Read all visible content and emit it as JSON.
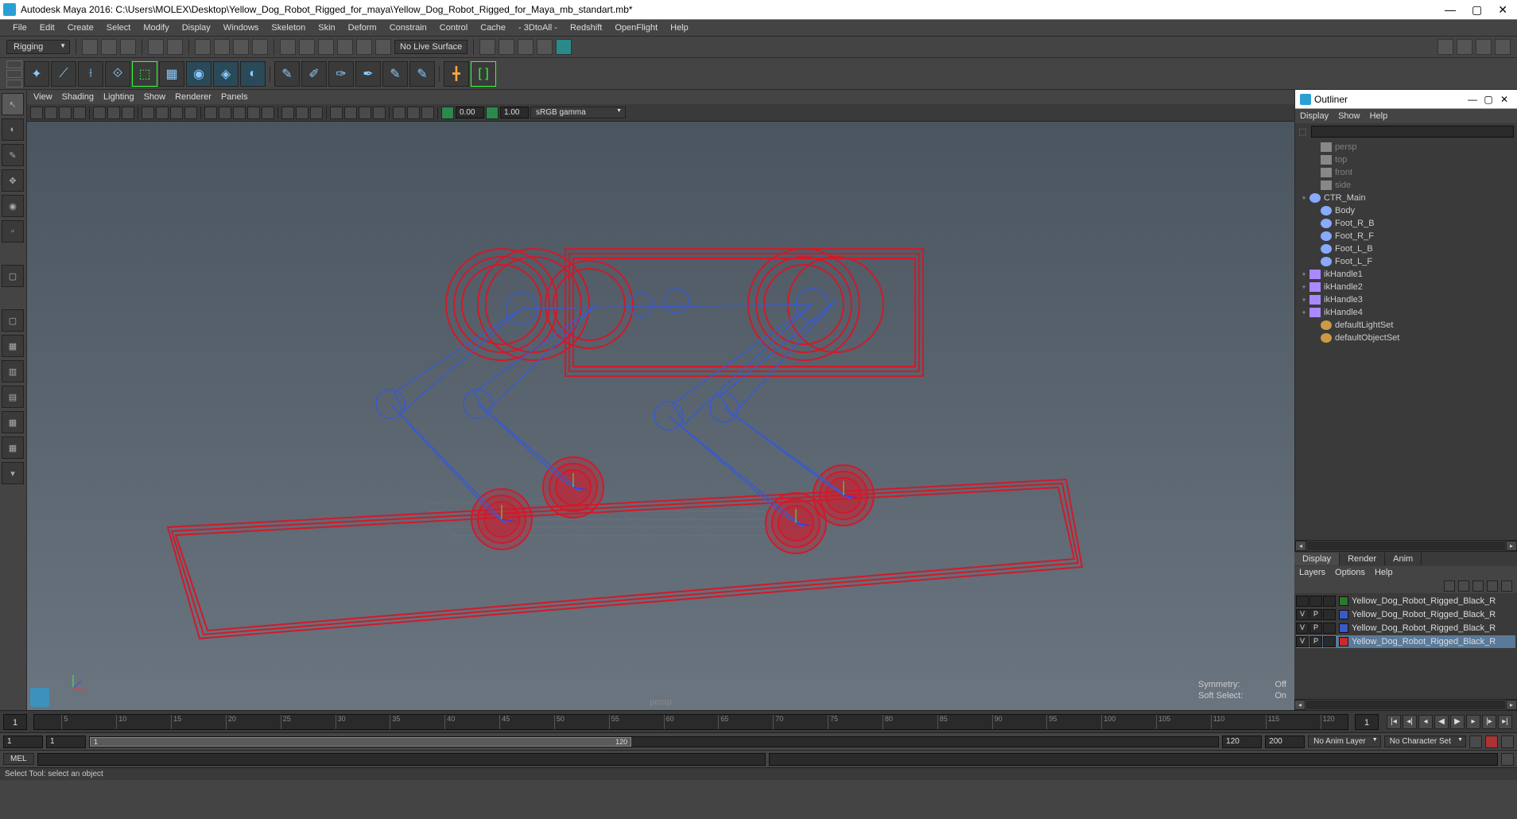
{
  "titlebar": {
    "text": "Autodesk Maya 2016: C:\\Users\\MOLEX\\Desktop\\Yellow_Dog_Robot_Rigged_for_maya\\Yellow_Dog_Robot_Rigged_for_Maya_mb_standart.mb*"
  },
  "menubar": {
    "items": [
      "File",
      "Edit",
      "Create",
      "Select",
      "Modify",
      "Display",
      "Windows",
      "Skeleton",
      "Skin",
      "Deform",
      "Constrain",
      "Control",
      "Cache",
      "- 3DtoAll -",
      "Redshift",
      "OpenFlight",
      "Help"
    ]
  },
  "workspace": {
    "selected": "Rigging"
  },
  "toolbar1": {
    "no_live_surface": "No Live Surface"
  },
  "panel_menu": {
    "items": [
      "View",
      "Shading",
      "Lighting",
      "Show",
      "Renderer",
      "Panels"
    ]
  },
  "panel_toolbar": {
    "val1": "0.00",
    "val2": "1.00",
    "color_mgmt": "sRGB gamma"
  },
  "viewport": {
    "camera": "persp",
    "symmetry_label": "Symmetry:",
    "symmetry_value": "Off",
    "soft_label": "Soft Select:",
    "soft_value": "On"
  },
  "outliner": {
    "title": "Outliner",
    "menu": [
      "Display",
      "Show",
      "Help"
    ],
    "items": [
      {
        "name": "persp",
        "type": "cam",
        "dimmed": true,
        "expand": "",
        "indent": 1
      },
      {
        "name": "top",
        "type": "cam",
        "dimmed": true,
        "expand": "",
        "indent": 1
      },
      {
        "name": "front",
        "type": "cam",
        "dimmed": true,
        "expand": "",
        "indent": 1
      },
      {
        "name": "side",
        "type": "cam",
        "dimmed": true,
        "expand": "",
        "indent": 1
      },
      {
        "name": "CTR_Main",
        "type": "nurbs",
        "dimmed": false,
        "expand": "+",
        "indent": 0
      },
      {
        "name": "Body",
        "type": "nurbs",
        "dimmed": false,
        "expand": "",
        "indent": 1
      },
      {
        "name": "Foot_R_B",
        "type": "nurbs",
        "dimmed": false,
        "expand": "",
        "indent": 1
      },
      {
        "name": "Foot_R_F",
        "type": "nurbs",
        "dimmed": false,
        "expand": "",
        "indent": 1
      },
      {
        "name": "Foot_L_B",
        "type": "nurbs",
        "dimmed": false,
        "expand": "",
        "indent": 1
      },
      {
        "name": "Foot_L_F",
        "type": "nurbs",
        "dimmed": false,
        "expand": "",
        "indent": 1
      },
      {
        "name": "ikHandle1",
        "type": "ik",
        "dimmed": false,
        "expand": "+",
        "indent": 0
      },
      {
        "name": "ikHandle2",
        "type": "ik",
        "dimmed": false,
        "expand": "+",
        "indent": 0
      },
      {
        "name": "ikHandle3",
        "type": "ik",
        "dimmed": false,
        "expand": "+",
        "indent": 0
      },
      {
        "name": "ikHandle4",
        "type": "ik",
        "dimmed": false,
        "expand": "+",
        "indent": 0
      },
      {
        "name": "defaultLightSet",
        "type": "set",
        "dimmed": false,
        "expand": "",
        "indent": 1
      },
      {
        "name": "defaultObjectSet",
        "type": "set",
        "dimmed": false,
        "expand": "",
        "indent": 1
      }
    ]
  },
  "chbox": {
    "tabs": [
      "Display",
      "Render",
      "Anim"
    ],
    "active_tab": "Display",
    "menu": [
      "Layers",
      "Options",
      "Help"
    ],
    "layers": [
      {
        "v": "",
        "p": "",
        "color": "#2a7a2a",
        "name": "Yellow_Dog_Robot_Rigged_Black_R",
        "selected": false
      },
      {
        "v": "V",
        "p": "P",
        "color": "#3a5acc",
        "name": "Yellow_Dog_Robot_Rigged_Black_R",
        "selected": false
      },
      {
        "v": "V",
        "p": "P",
        "color": "#3a5acc",
        "name": "Yellow_Dog_Robot_Rigged_Black_R",
        "selected": false
      },
      {
        "v": "V",
        "p": "P",
        "color": "#cc2a2a",
        "name": "Yellow_Dog_Robot_Rigged_Black_R",
        "selected": true
      }
    ]
  },
  "timeline": {
    "current": "1",
    "end": "1",
    "ticks": [
      "5",
      "10",
      "15",
      "20",
      "25",
      "30",
      "35",
      "40",
      "45",
      "50",
      "55",
      "60",
      "65",
      "70",
      "75",
      "80",
      "85",
      "90",
      "95",
      "100",
      "105",
      "110",
      "115",
      "120"
    ]
  },
  "range": {
    "start": "1",
    "ps": "1",
    "handle": "1",
    "pe_val": "120",
    "pe": "120",
    "end": "200",
    "anim_layer": "No Anim Layer",
    "char_set": "No Character Set"
  },
  "cmd": {
    "lang": "MEL"
  },
  "helpline": {
    "text": "Select Tool: select an object"
  }
}
